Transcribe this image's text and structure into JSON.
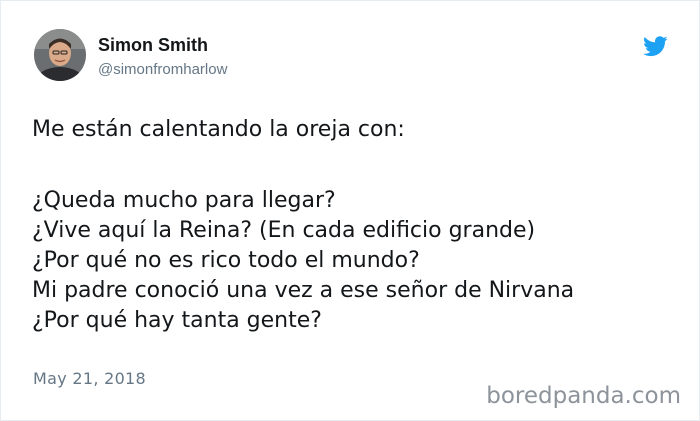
{
  "tweet": {
    "author": {
      "name": "Simon Smith",
      "handle": "@simonfromharlow"
    },
    "intro": "Me están calentando la oreja con:",
    "lines": [
      "¿Queda mucho para llegar?",
      "¿Vive aquí la Reina? (En cada edificio grande)",
      "¿Por qué no es rico todo el mundo?",
      "Mi padre conoció una vez a ese señor de Nirvana",
      "¿Por qué hay tanta gente?"
    ],
    "timestamp": "May 21, 2018"
  },
  "icons": {
    "platform": "twitter-bird-icon",
    "avatar": "profile-photo"
  },
  "colors": {
    "text": "#14171a",
    "secondary_text": "#657786",
    "brand_blue": "#1da1f2",
    "border": "#e6ecf0",
    "watermark": "#8d939a"
  },
  "watermark": "boredpanda.com"
}
